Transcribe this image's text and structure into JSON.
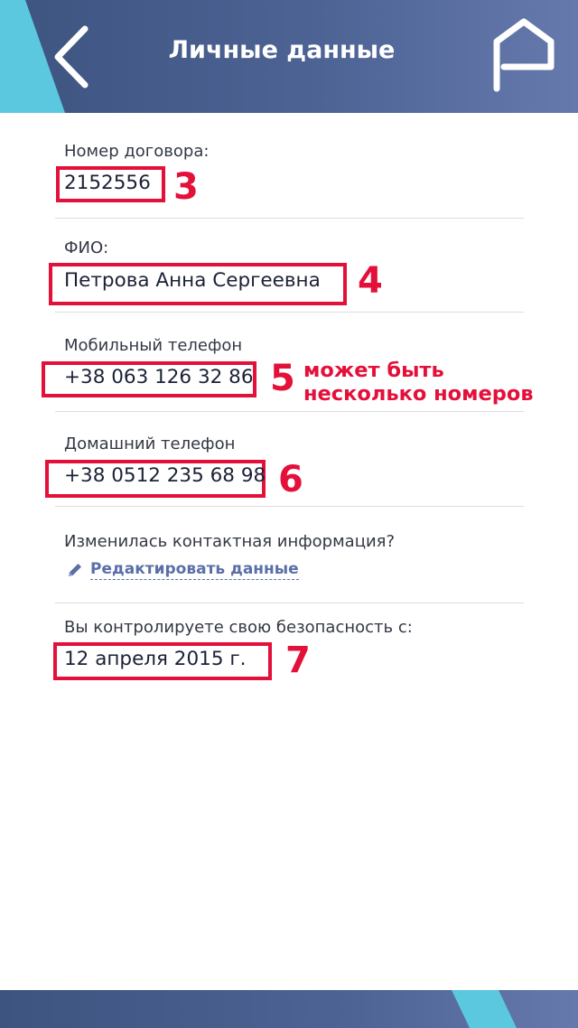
{
  "header": {
    "title": "Личные данные",
    "icons": [
      "back-arrow",
      "feedback-flag"
    ]
  },
  "fields": {
    "contract": {
      "label": "Номер договора:",
      "value": "2152556",
      "marker": "3"
    },
    "fio": {
      "label": "ФИО:",
      "value": "Петрова Анна Сергеевна",
      "marker": "4"
    },
    "mobile": {
      "label": "Мобильный телефон",
      "value": "+38 063 126 32 86",
      "marker": "5"
    },
    "home": {
      "label": "Домашний телефон",
      "value": "+38 0512 235 68 98",
      "marker": "6"
    },
    "since": {
      "label": "Вы контролируете свою безопасность с:",
      "value": "12 апреля 2015 г.",
      "marker": "7"
    }
  },
  "annotation": {
    "line1": "может быть",
    "line2": "несколько номеров"
  },
  "contact_change": {
    "question": "Изменилась контактная информация?",
    "edit_label": "Редактировать данные"
  },
  "colors": {
    "header": "#4d6394",
    "accent_teal": "#5bc8df",
    "marker_red": "#e3103a",
    "link": "#5a6fa8"
  }
}
